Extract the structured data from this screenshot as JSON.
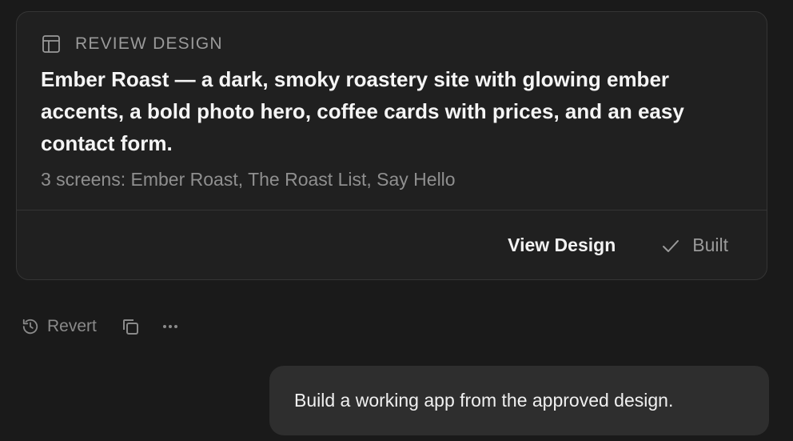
{
  "review_card": {
    "label": "REVIEW DESIGN",
    "title": "Ember Roast — a dark, smoky roastery site with glowing ember accents, a bold photo hero, coffee cards with prices, and an easy contact form.",
    "screens_summary": "3 screens: Ember Roast, The Roast List, Say Hello",
    "view_design_label": "View Design",
    "status_label": "Built",
    "icons": {
      "header": "layout-icon",
      "status": "check-icon"
    }
  },
  "toolbar": {
    "revert_label": "Revert",
    "icons": {
      "revert": "history-icon",
      "copy": "copy-icon",
      "more": "more-horizontal-icon"
    }
  },
  "user_message": {
    "text": "Build a working app from the approved design."
  },
  "colors": {
    "background": "#1a1a1a",
    "card": "#202020",
    "border": "#353535",
    "bubble": "#2e2e2e",
    "muted_text": "#8f8f8f"
  }
}
